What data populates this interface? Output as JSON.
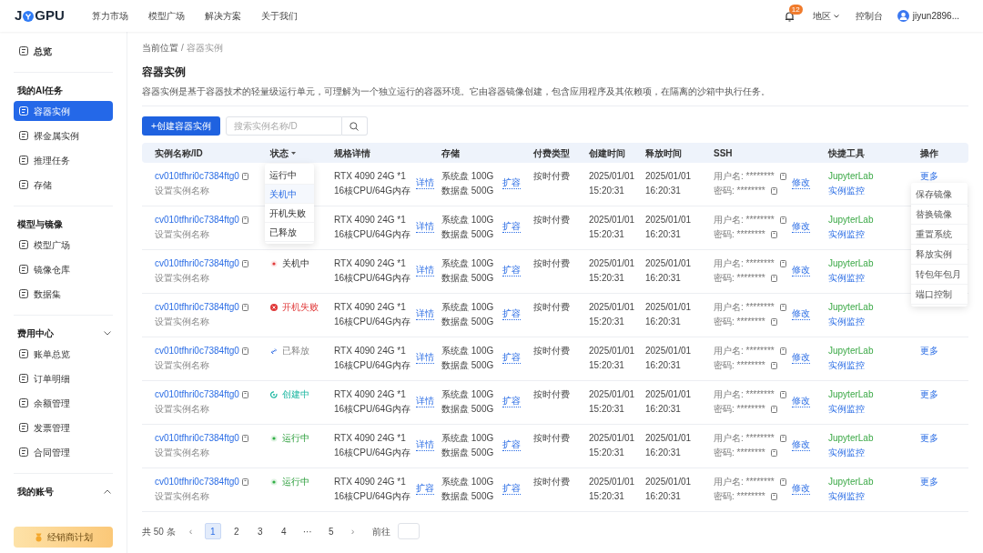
{
  "topbar": {
    "logo_left": "J",
    "logo_right": "GPU",
    "menu": [
      "算力市场",
      "模型广场",
      "解决方案",
      "关于我们"
    ],
    "notification_count": "12",
    "region": "地区",
    "console": "控制台",
    "user": "jiyun2896..."
  },
  "sidebar": {
    "sections": [
      {
        "items": [
          {
            "label": "总览",
            "selected": false
          }
        ]
      },
      {
        "title": "我的AI任务",
        "items": [
          {
            "label": "容器实例",
            "selected": true
          },
          {
            "label": "裸金属实例",
            "selected": false
          },
          {
            "label": "推理任务",
            "selected": false
          },
          {
            "label": "存储",
            "selected": false
          }
        ]
      },
      {
        "title": "模型与镜像",
        "items": [
          {
            "label": "模型广场",
            "selected": false
          },
          {
            "label": "镜像仓库",
            "selected": false
          },
          {
            "label": "数据集",
            "selected": false
          }
        ]
      },
      {
        "title": "费用中心",
        "expanded": true,
        "items": [
          {
            "label": "账单总览",
            "selected": false
          },
          {
            "label": "订单明细",
            "selected": false
          },
          {
            "label": "余额管理",
            "selected": false
          },
          {
            "label": "发票管理",
            "selected": false
          },
          {
            "label": "合同管理",
            "selected": false
          }
        ]
      },
      {
        "title": "我的账号",
        "expanded": false
      }
    ],
    "promo": "经销商计划"
  },
  "breadcrumb": [
    "当前位置",
    "容器实例"
  ],
  "breadcrumb_separator": "/",
  "page_title": "容器实例",
  "description": "容器实例是基于容器技术的轻量级运行单元，可理解为一个独立运行的容器环境。它由容器镜像创建，包含应用程序及其依赖项，在隔离的沙箱中执行任务。",
  "create_button": "+创建容器实例",
  "search": {
    "placeholder": "搜索实例名称/D"
  },
  "table": {
    "columns": [
      {
        "label": "实例名称/ID",
        "filter": false
      },
      {
        "label": "状态",
        "filter": true
      },
      {
        "label": "规格详情",
        "filter": false
      },
      {
        "label": "存储",
        "filter": false
      },
      {
        "label": "付费类型",
        "filter": false
      },
      {
        "label": "创建时间",
        "filter": false
      },
      {
        "label": "释放时间",
        "filter": false
      },
      {
        "label": "SSH",
        "filter": false
      },
      {
        "label": "快捷工具",
        "filter": false
      },
      {
        "label": "操作",
        "filter": false
      }
    ],
    "rows": [
      {
        "id": "cv010tfhri0c7384ftg0",
        "name": "设置实例名称",
        "spec": [
          "RTX 4090 24G *1",
          "16核CPU/64G内存"
        ],
        "spec_link": "详情",
        "storage": [
          "系统盘 100G",
          "数据盘 500G"
        ],
        "storage_link": "扩容",
        "billing": "按时付费",
        "created": [
          "2025/01/01",
          "15:20:31"
        ],
        "released": [
          "2025/01/01",
          "16:20:31"
        ],
        "ssh_user": "用户名: ********",
        "ssh_password": "密码: ********",
        "ssh_link": "修改",
        "tools": [
          "JupyterLab",
          "实例监控"
        ],
        "action": "更多"
      },
      {
        "id": "cv010tfhri0c7384ftg0",
        "name": "设置实例名称",
        "spec": [
          "RTX 4090 24G *1",
          "16核CPU/64G内存"
        ],
        "spec_link": "详情",
        "storage": [
          "系统盘 100G",
          "数据盘 500G"
        ],
        "storage_link": "扩容",
        "billing": "按时付费",
        "created": [
          "2025/01/01",
          "15:20:31"
        ],
        "released": [
          "2025/01/01",
          "16:20:31"
        ],
        "ssh_user": "用户名: ********",
        "ssh_password": "密码: ********",
        "ssh_link": "修改",
        "tools": [
          "JupyterLab",
          "实例监控"
        ]
      },
      {
        "id": "cv010tfhri0c7384ftg0",
        "name": "设置实例名称",
        "status": {
          "kind": "stopped",
          "label": "关机中"
        },
        "spec": [
          "RTX 4090 24G *1",
          "16核CPU/64G内存"
        ],
        "spec_link": "详情",
        "storage": [
          "系统盘 100G",
          "数据盘 500G"
        ],
        "storage_link": "扩容",
        "billing": "按时付费",
        "created": [
          "2025/01/01",
          "15:20:31"
        ],
        "released": [
          "2025/01/01",
          "16:20:31"
        ],
        "ssh_user": "用户名: ********",
        "ssh_password": "密码: ********",
        "ssh_link": "修改",
        "tools": [
          "JupyterLab",
          "实例监控"
        ]
      },
      {
        "id": "cv010tfhri0c7384ftg0",
        "name": "设置实例名称",
        "status": {
          "kind": "failed",
          "label": "开机失败"
        },
        "spec": [
          "RTX 4090 24G *1",
          "16核CPU/64G内存"
        ],
        "spec_link": "详情",
        "storage": [
          "系统盘 100G",
          "数据盘 500G"
        ],
        "storage_link": "扩容",
        "billing": "按时付费",
        "created": [
          "2025/01/01",
          "15:20:31"
        ],
        "released": [
          "2025/01/01",
          "16:20:31"
        ],
        "ssh_user": "用户名: ********",
        "ssh_password": "密码: ********",
        "ssh_link": "修改",
        "tools": [
          "JupyterLab",
          "实例监控"
        ]
      },
      {
        "id": "cv010tfhri0c7384ftg0",
        "name": "设置实例名称",
        "status": {
          "kind": "released",
          "label": "已释放"
        },
        "spec": [
          "RTX 4090 24G *1",
          "16核CPU/64G内存"
        ],
        "spec_link": "详情",
        "storage": [
          "系统盘 100G",
          "数据盘 500G"
        ],
        "storage_link": "扩容",
        "billing": "按时付费",
        "created": [
          "2025/01/01",
          "15:20:31"
        ],
        "released": [
          "2025/01/01",
          "16:20:31"
        ],
        "ssh_user": "用户名: ********",
        "ssh_password": "密码: ********",
        "ssh_link": "修改",
        "tools": [
          "JupyterLab",
          "实例监控"
        ],
        "action": "更多"
      },
      {
        "id": "cv010tfhri0c7384ftg0",
        "name": "设置实例名称",
        "status": {
          "kind": "creating",
          "label": "创建中"
        },
        "spec": [
          "RTX 4090 24G *1",
          "16核CPU/64G内存"
        ],
        "spec_link": "详情",
        "storage": [
          "系统盘 100G",
          "数据盘 500G"
        ],
        "storage_link": "扩容",
        "billing": "按时付费",
        "created": [
          "2025/01/01",
          "15:20:31"
        ],
        "released": [
          "2025/01/01",
          "16:20:31"
        ],
        "ssh_user": "用户名: ********",
        "ssh_password": "密码: ********",
        "ssh_link": "修改",
        "tools": [
          "JupyterLab",
          "实例监控"
        ],
        "action": "更多"
      },
      {
        "id": "cv010tfhri0c7384ftg0",
        "name": "设置实例名称",
        "status": {
          "kind": "running",
          "label": "运行中"
        },
        "spec": [
          "RTX 4090 24G *1",
          "16核CPU/64G内存"
        ],
        "spec_link": "详情",
        "storage": [
          "系统盘 100G",
          "数据盘 500G"
        ],
        "storage_link": "扩容",
        "billing": "按时付费",
        "created": [
          "2025/01/01",
          "15:20:31"
        ],
        "released": [
          "2025/01/01",
          "16:20:31"
        ],
        "ssh_user": "用户名: ********",
        "ssh_password": "密码: ********",
        "ssh_link": "修改",
        "tools": [
          "JupyterLab",
          "实例监控"
        ],
        "action": "更多"
      },
      {
        "id": "cv010tfhri0c7384ftg0",
        "name": "设置实例名称",
        "status": {
          "kind": "running",
          "label": "运行中"
        },
        "spec": [
          "RTX 4090 24G *1",
          "16核CPU/64G内存"
        ],
        "spec_link": "扩容",
        "storage": [
          "系统盘 100G",
          "数据盘 500G"
        ],
        "storage_link": "扩容",
        "billing": "按时付费",
        "created": [
          "2025/01/01",
          "15:20:31"
        ],
        "released": [
          "2025/01/01",
          "16:20:31"
        ],
        "ssh_user": "用户名: ********",
        "ssh_password": "密码: ********",
        "ssh_link": "修改",
        "tools": [
          "JupyterLab",
          "实例监控"
        ],
        "action": "更多"
      }
    ]
  },
  "status_menu": [
    {
      "label": "运行中",
      "selected": false
    },
    {
      "label": "关机中",
      "selected": true
    },
    {
      "label": "开机失败",
      "selected": false
    },
    {
      "label": "已释放",
      "selected": false
    }
  ],
  "action_menu": [
    "保存镜像",
    "替换镜像",
    "重置系统",
    "释放实例",
    "转包年包月",
    "端口控制"
  ],
  "pagination": {
    "total": "共 50 条",
    "prev": "‹",
    "pages": [
      {
        "label": "1",
        "selected": true
      },
      {
        "label": "2",
        "selected": false
      },
      {
        "label": "3",
        "selected": false
      },
      {
        "label": "4",
        "selected": false
      },
      {
        "label": "···",
        "selected": false
      },
      {
        "label": "5",
        "selected": false
      }
    ],
    "next": "›",
    "jump_label": "前往"
  }
}
